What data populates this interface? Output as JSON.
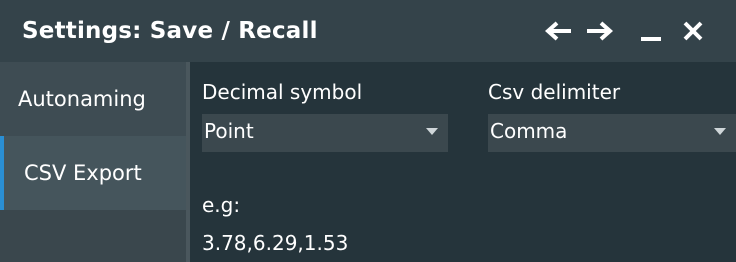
{
  "window": {
    "title": "Settings: Save / Recall",
    "buttons": {
      "back_icon": "arrow-left-icon",
      "forward_icon": "arrow-right-icon",
      "minimize_icon": "minimize-icon",
      "close_icon": "close-icon"
    }
  },
  "sidebar": {
    "tabs": [
      {
        "label": "Autonaming",
        "selected": false
      },
      {
        "label": "CSV Export",
        "selected": true
      }
    ]
  },
  "main": {
    "decimal_symbol": {
      "label": "Decimal symbol",
      "value": "Point"
    },
    "csv_delimiter": {
      "label": "Csv delimiter",
      "value": "Comma"
    },
    "example": {
      "label": "e.g:",
      "value": "3.78,6.29,1.53"
    }
  },
  "colors": {
    "titlebar_bg": "#34434a",
    "body_bg": "#25343b",
    "selected_tab_accent": "#2a8fd4",
    "dropdown_bg": "#3b484e"
  }
}
